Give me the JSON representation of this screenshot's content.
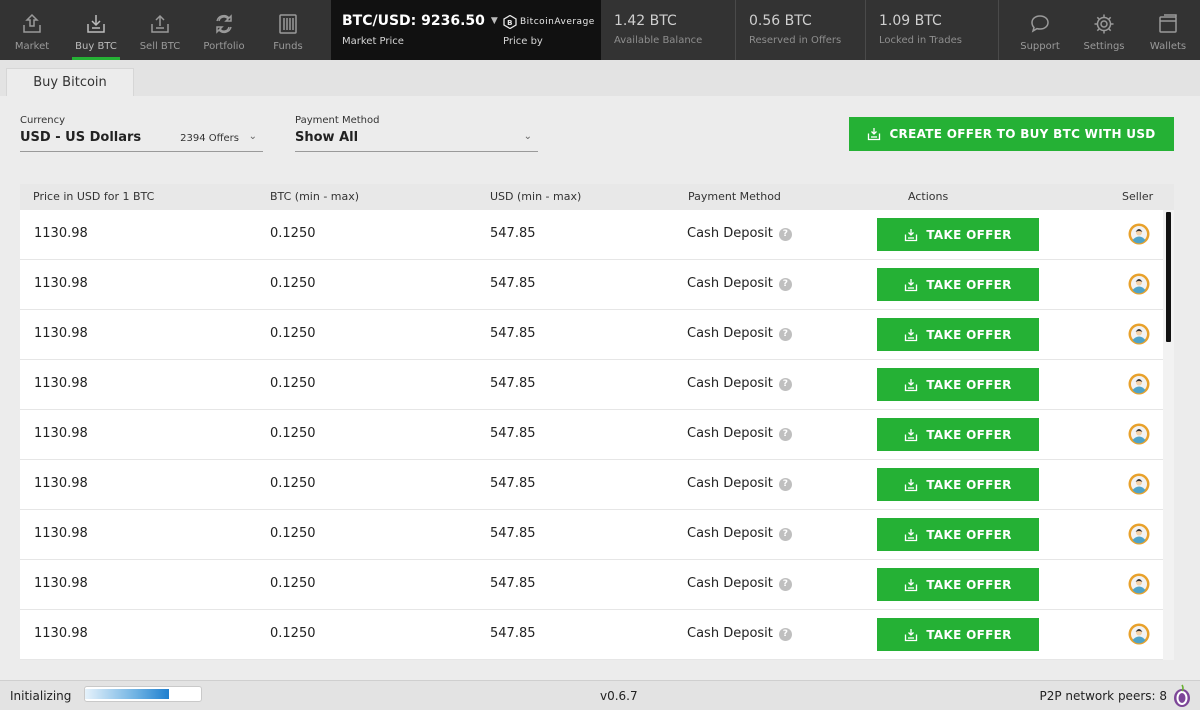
{
  "nav": {
    "left": [
      {
        "label": "Market",
        "icon": "market-icon"
      },
      {
        "label": "Buy BTC",
        "icon": "buy-btc-icon",
        "active": true
      },
      {
        "label": "Sell BTC",
        "icon": "sell-btc-icon"
      },
      {
        "label": "Portfolio",
        "icon": "portfolio-icon"
      },
      {
        "label": "Funds",
        "icon": "funds-icon"
      }
    ],
    "right": [
      {
        "label": "Support",
        "icon": "support-icon"
      },
      {
        "label": "Settings",
        "icon": "settings-icon"
      },
      {
        "label": "Wallets",
        "icon": "wallets-icon"
      }
    ]
  },
  "market_price": {
    "value": "BTC/USD: 9236.50",
    "label": "Market Price",
    "provider": "BitcoinAverage",
    "provider_label": "Price by"
  },
  "balances": [
    {
      "value": "1.42 BTC",
      "label": "Available Balance"
    },
    {
      "value": "0.56 BTC",
      "label": "Reserved in Offers"
    },
    {
      "value": "1.09 BTC",
      "label": "Locked in Trades"
    }
  ],
  "tab": {
    "label": "Buy Bitcoin"
  },
  "filters": {
    "currency_label": "Currency",
    "currency_value": "USD - US Dollars",
    "offers_count": "2394 Offers",
    "payment_label": "Payment Method",
    "payment_value": "Show All"
  },
  "create_button": "CREATE OFFER TO BUY BTC WITH USD",
  "table": {
    "headers": [
      "Price in USD for 1 BTC",
      "BTC (min - max)",
      "USD (min - max)",
      "Payment Method",
      "Actions",
      "Seller"
    ],
    "action_label": "TAKE OFFER",
    "rows": [
      {
        "price": "1130.98",
        "btc": "0.1250",
        "usd": "547.85",
        "method": "Cash Deposit"
      },
      {
        "price": "1130.98",
        "btc": "0.1250",
        "usd": "547.85",
        "method": "Cash Deposit"
      },
      {
        "price": "1130.98",
        "btc": "0.1250",
        "usd": "547.85",
        "method": "Cash Deposit"
      },
      {
        "price": "1130.98",
        "btc": "0.1250",
        "usd": "547.85",
        "method": "Cash Deposit"
      },
      {
        "price": "1130.98",
        "btc": "0.1250",
        "usd": "547.85",
        "method": "Cash Deposit"
      },
      {
        "price": "1130.98",
        "btc": "0.1250",
        "usd": "547.85",
        "method": "Cash Deposit"
      },
      {
        "price": "1130.98",
        "btc": "0.1250",
        "usd": "547.85",
        "method": "Cash Deposit"
      },
      {
        "price": "1130.98",
        "btc": "0.1250",
        "usd": "547.85",
        "method": "Cash Deposit"
      },
      {
        "price": "1130.98",
        "btc": "0.1250",
        "usd": "547.85",
        "method": "Cash Deposit"
      }
    ]
  },
  "status": {
    "text": "Initializing",
    "progress": 0.72,
    "version": "v0.6.7",
    "peers": "P2P network peers: 8"
  },
  "colors": {
    "accent": "#25b135",
    "topbar": "#333333",
    "price_box": "#111111"
  }
}
